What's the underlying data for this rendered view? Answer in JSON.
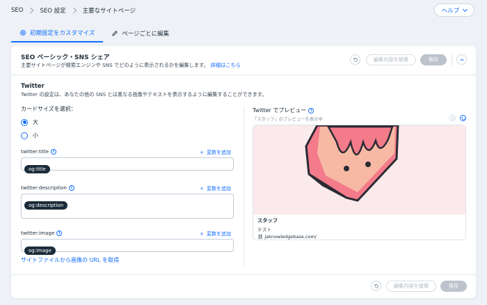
{
  "breadcrumb": [
    "SEO",
    "SEO 設定",
    "主要なサイトページ"
  ],
  "help_label": "ヘルプ",
  "tabs": [
    {
      "label": "初期設定をカスタマイズ",
      "active": true
    },
    {
      "label": "ページごとに編集",
      "active": false
    }
  ],
  "card": {
    "title": "SEO ベーシック・SNS シェア",
    "subtitle": "主要サイトページが検索エンジンや SNS でどのように表示されるかを編集します。",
    "details_link": "詳細はこちら",
    "discard_label": "編集内容を破棄",
    "save_label": "保存"
  },
  "section": {
    "title": "Twitter",
    "description": "Twitter の設定は、あなたの他の SNS とは異なる画像やテキストを表示するように編集することができます。"
  },
  "card_size": {
    "label": "カードサイズを選択：",
    "options": [
      {
        "label": "大",
        "selected": true
      },
      {
        "label": "小",
        "selected": false
      }
    ]
  },
  "fields": [
    {
      "label": "twitter:title",
      "add_var": "変数を追加",
      "value": "og:title"
    },
    {
      "label": "twitter:description",
      "add_var": "変数を追加",
      "value": "og:description"
    },
    {
      "label": "twitter:image",
      "add_var": "変数を追加",
      "value": "og:image"
    }
  ],
  "image_link": "サイトファイルから画像の URL を取得",
  "preview": {
    "title": "Twitter でプレビュー",
    "subtitle": "「スタッフ」のプレビューを表示中",
    "name": "スタッフ",
    "desc": "テスト",
    "url": "jaknowledgebase.com/"
  },
  "colors": {
    "accent": "#116dff",
    "pill": "#1c2b3a",
    "save_disabled": "#bcc3cc",
    "cake": "#f37b8a",
    "cake_cream": "#f7b9a4",
    "preview_bg": "#fbeaeb"
  }
}
